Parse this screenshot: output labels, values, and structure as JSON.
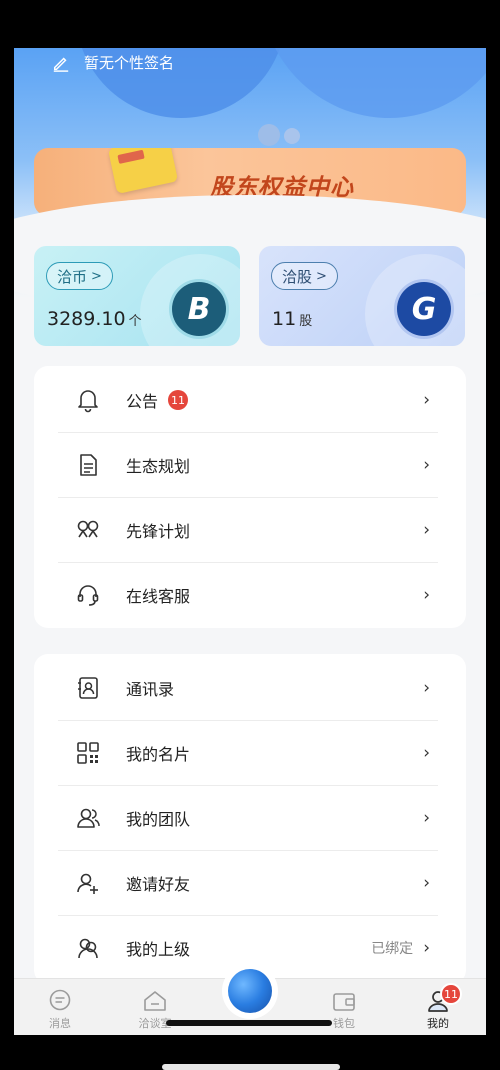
{
  "header": {
    "signature": "暂无个性签名",
    "banner_title": "股东权益中心"
  },
  "assets": {
    "coin": {
      "label": "洽币",
      "amount": "3289.10",
      "unit": "个",
      "logo": "B"
    },
    "share": {
      "label": "洽股",
      "amount": "11",
      "unit": "股",
      "logo": "G"
    }
  },
  "menu1": [
    {
      "label": "公告",
      "badge": "11",
      "icon": "bell-icon"
    },
    {
      "label": "生态规划",
      "icon": "document-icon"
    },
    {
      "label": "先锋计划",
      "icon": "pioneer-icon"
    },
    {
      "label": "在线客服",
      "icon": "headset-icon"
    }
  ],
  "menu2": [
    {
      "label": "通讯录",
      "icon": "contacts-icon"
    },
    {
      "label": "我的名片",
      "icon": "qrcode-icon"
    },
    {
      "label": "我的团队",
      "icon": "team-icon"
    },
    {
      "label": "邀请好友",
      "icon": "add-user-icon"
    },
    {
      "label": "我的上级",
      "status": "已绑定",
      "icon": "superior-icon"
    }
  ],
  "arrow": "›",
  "tabs": [
    {
      "label": "消息",
      "icon": "message-icon"
    },
    {
      "label": "洽谈室",
      "icon": "house-icon"
    },
    {
      "label": "",
      "icon": "globe-icon"
    },
    {
      "label": "钱包",
      "icon": "wallet-icon"
    },
    {
      "label": "我的",
      "badge": "11",
      "icon": "profile-icon"
    }
  ],
  "colors": {
    "accent": "#2a7de1",
    "badge": "#e5463c",
    "banner_text": "#c2461c"
  }
}
